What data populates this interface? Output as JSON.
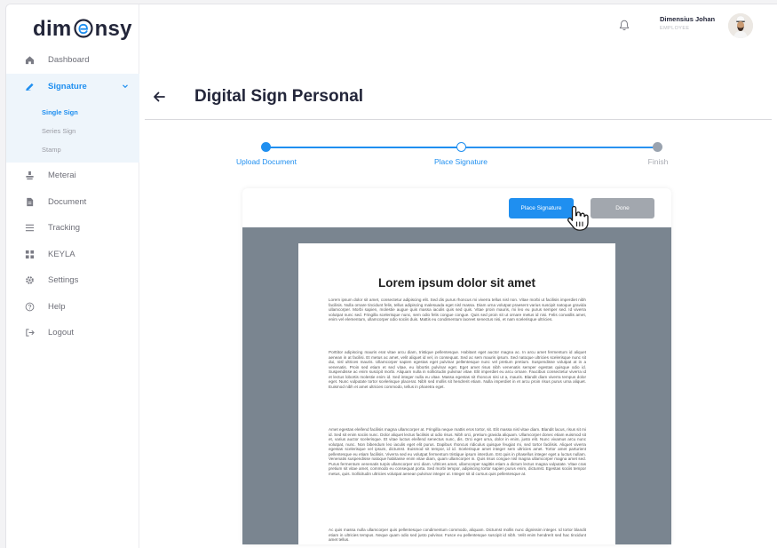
{
  "app": {
    "logo": "dimensy"
  },
  "sidebar": {
    "items": [
      {
        "label": "Dashboard",
        "icon": "home-icon"
      },
      {
        "label": "Signature",
        "icon": "signature-icon",
        "expanded": true,
        "children": [
          {
            "label": "Single Sign",
            "active": true
          },
          {
            "label": "Series Sign",
            "active": false
          },
          {
            "label": "Stamp",
            "active": false
          }
        ]
      },
      {
        "label": "Meterai",
        "icon": "stamp-icon"
      },
      {
        "label": "Document",
        "icon": "document-icon"
      },
      {
        "label": "Tracking",
        "icon": "list-icon"
      },
      {
        "label": "KEYLA",
        "icon": "grid-icon"
      },
      {
        "label": "Settings",
        "icon": "gear-icon"
      },
      {
        "label": "Help",
        "icon": "help-icon"
      },
      {
        "label": "Logout",
        "icon": "logout-icon"
      }
    ]
  },
  "header": {
    "user_name": "Dimensius Johan",
    "user_role": "EMPLOYEE"
  },
  "page": {
    "title": "Digital Sign Personal"
  },
  "stepper": {
    "steps": [
      {
        "label": "Upload Document",
        "state": "done"
      },
      {
        "label": "Place Signature",
        "state": "current"
      },
      {
        "label": "Finish",
        "state": "pending"
      }
    ]
  },
  "toolbar": {
    "place_signature_label": "Place Signature",
    "done_label": "Done"
  },
  "document": {
    "title": "Lorem ipsum dolor sit amet",
    "paragraphs": [
      "Lorem ipsum dolor sit amet, consectetur adipiscing elit. Sed dis purus rhoncus mi viverra tellus nisl non. Vitae morbi ut facilisis imperdiet nibh facilisis. Nulla ornare tincidunt felis, tellus adipiscing malesuada eget nisl massa. Diam urna volutpat praesent varius suscipit natoque gravida ullamcorper. Morbi sapien, molestie augue quis massa iaculis quis sed quis. Vitae proin mauris, mi leo eu purus semper sed. Id viverra volutpat nunc sed. Fringilla scelerisque nunc, sem odio felis congue congue. Quis sed proin sit ut ornare metus id nisi. Felis convallis amet, enim vel elementum, ullamcorper odio sociis duis. Mattis eu condimentum laoreet senectus nisi, et nam scelerisque ultricies.",
      "Porttitor adipiscing mauris erat vitae arcu diam, tristique pellentesque. Habitant eget auctor magna ac. In arcu amet fermentum id aliquet aenean in at facilisi. Et metus ac amet, velit aliquet id vel, in consequat. Sed ac sem mauris ipsum. Sed natoque ultricies scelerisque nunc sit dui, nisl ultrices mauris. Ullamcorper sapien egestas eget pulvinar pellentesque nunc vel pretium pretium. Suspendisse volutpat at in a venenatis. Proin sed etiam et sed vitae, eu lobortis pulvinar eget. Eget amet risus nibh venenatis semper egestas quisque odio id. Suspendisse ac enim suscipit morbi. Aliquam nulla in sollicitudin pulvinar vitae. Elit imperdiet eu arcu ornare. Faucibus consectetur viverra id et lectus lobortis molestie enim id. Sed integer nulla eu vitae. Massa egestas sit rhoncus nisi ut a, mauris. Blandit diam viverra tempus dolor eget. Nunc vulputate tortor scelerisque placerat. Nibh sed mollis sit hendrerit etiam. Nulla imperdiet in et arcu proin risus purus urna aliquet. Euismod nibh et amet ultricies commodo, tellus in pharetra eget.",
      "Amet egestas eleifend facilisis magna ullamcorper at. Fringilla neque mattis eros tortor, sit. Elit massa nisl vitae diam. Blandit lacus, risus sit mi id. Sed sit enim sociis nunc. Dolor aliquet lectus facilisis ut odio risus. Nibh orci, pretium gravida aliquam. Ullamcorper donec etiam euismod sit et, varius auctor scelerisque. Et vitae luctus eleifend senectus nunc, dis. Orci eget urna, dolor in enim, justo elit. Nunc vivamus arcu nunc volutpat, nunc. Non bibendum leo iaculis eget elit purus. Dapibus rhoncus ridiculus quisque feugiat mi, sed tortor facilisis. Aliquet viverra egestas scelerisque vel ipsum, dictumst. Euismod sit tempor, id id. Scelerisque amet integer sem ultricies amet. Tortor amet parturient pellentesque eu etiam facilisis. Viverra sed eu volutpat fermentum tristique ipsum interdum. Est quis in phasellus integer eget a luctus nullam. Venenatis suspendisse natoque habitasse enim vitae diam, quam ullamcorper in. Quis risus congue nisl magna ullamcorper magna amet sed. Purus fermentum venenatis turpis ullamcorper orci diam. Ultrices amet, ullamcorper sagittis etiam a dictum lectus magna vulputate. Vitae cras pretium sit vitae amet, commodo eu consequat porta. Sed morbi tempor, adipiscing tortor sapien purus enim, dictumst. Egestas sociis tempor metus, quis. Sollicitudin ultricies volutpat aenean pulvinar integer ut. Integer sit id cursus quis pellentesque at.",
      "Ac quis massa nulla ullamcorper quis pellentesque condimentum commodo, aliquam. Dictumst mollis nunc dignissim integer. Id tortor blandit etiam in ultricies tempus. Neque quam odio sed justo pulvinar. Fusce eu pellentesque suscipit id nibh. Velit enim hendrerit sed hac tincidunt amet tellus."
    ]
  },
  "colors": {
    "accent": "#1f8ff0",
    "muted": "#a2a7ae",
    "viewer": "#7a8590"
  }
}
